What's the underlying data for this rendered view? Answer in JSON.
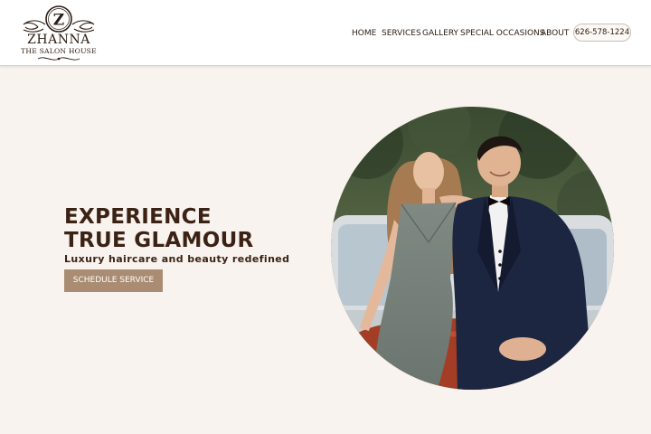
{
  "brand": {
    "emblem_letter": "Z",
    "name": "ZHANNA",
    "tagline": "THE SALON HOUSE"
  },
  "nav": {
    "items": [
      {
        "label": "HOME"
      },
      {
        "label": "SERVICES"
      },
      {
        "label": "GALLERY"
      },
      {
        "label": "SPECIAL OCCASIONS"
      },
      {
        "label": "ABOUT"
      }
    ],
    "phone": "626-578-1224"
  },
  "hero": {
    "title_line1": "EXPERIENCE",
    "title_line2": "TRUE GLAMOUR",
    "subtitle": "Luxury haircare and beauty redefined",
    "cta_label": "SCHEDULE SERVICE"
  },
  "colors": {
    "page_background": "#f8f3ef",
    "header_background": "#ffffff",
    "heading_text": "#3b2214",
    "button_background": "#a98c72",
    "button_text": "#ffffff"
  }
}
